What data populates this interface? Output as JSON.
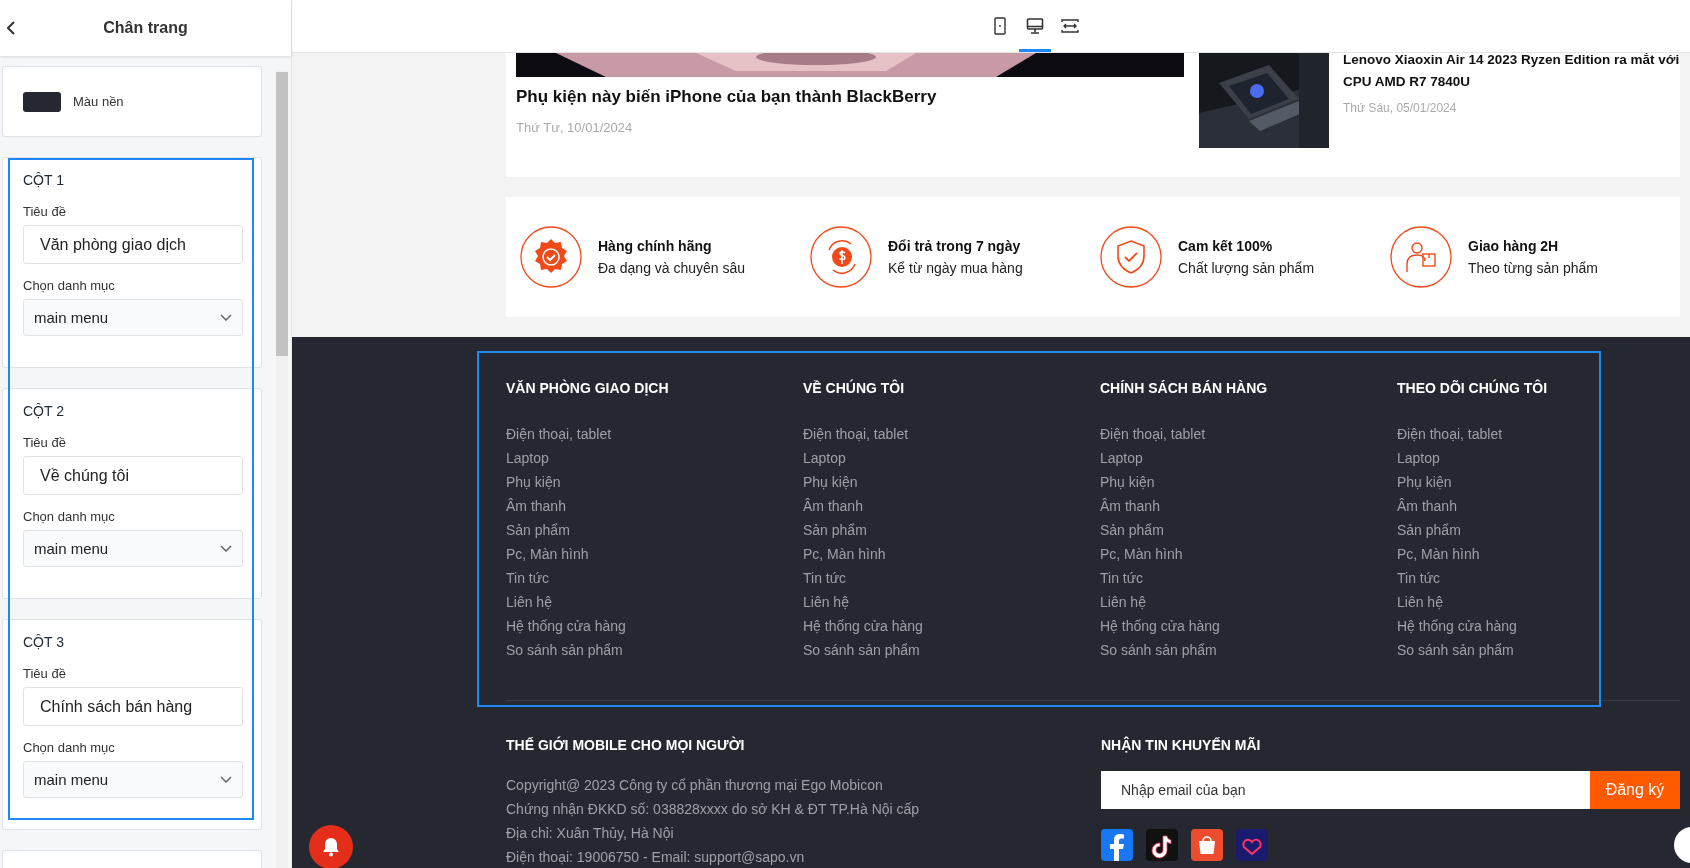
{
  "panel": {
    "title": "Chân trang",
    "background": {
      "label": "Màu nền",
      "color": "#252830"
    },
    "columns": [
      {
        "heading": "CỘT 1",
        "title_label": "Tiêu đề",
        "title_value": "Văn phòng giao dịch",
        "menu_label": "Chọn danh mục",
        "menu_value": "main menu"
      },
      {
        "heading": "CỘT 2",
        "title_label": "Tiêu đề",
        "title_value": "Về chúng tôi",
        "menu_label": "Chọn danh mục",
        "menu_value": "main menu"
      },
      {
        "heading": "CỘT 3",
        "title_label": "Tiêu đề",
        "title_value": "Chính sách bán hàng",
        "menu_label": "Chọn danh mục",
        "menu_value": "main menu"
      }
    ]
  },
  "toolbar": {
    "devices": [
      {
        "kind": "tablet",
        "selected": false
      },
      {
        "kind": "desktop",
        "selected": true
      },
      {
        "kind": "fit",
        "selected": false
      }
    ]
  },
  "news": {
    "main": {
      "kind": "picture",
      "title": "Phụ kiện này biến iPhone của bạn thành BlackBerry",
      "date": "Thứ Tư, 10/01/2024"
    },
    "side": {
      "kind": "picture",
      "title": "Lenovo Xiaoxin Air 14 2023 Ryzen Edition ra mắt với CPU AMD R7 7840U",
      "date": "Thứ Sáu, 05/01/2024"
    }
  },
  "features": [
    {
      "kind": "badge",
      "title": "Hàng chính hãng",
      "subtitle": "Đa dạng và chuyên sâu"
    },
    {
      "kind": "refund",
      "title": "Đổi trả trong 7 ngày",
      "subtitle": "Kể từ ngày mua hàng"
    },
    {
      "kind": "shield",
      "title": "Cam kết 100%",
      "subtitle": "Chất lượng sản phẩm"
    },
    {
      "kind": "delivery",
      "title": "Giao hàng 2H",
      "subtitle": "Theo từng sản phẩm"
    }
  ],
  "footer": {
    "columns": [
      {
        "heading": "VĂN PHÒNG GIAO DỊCH",
        "links": [
          "Điện thoại, tablet",
          "Laptop",
          "Phụ kiện",
          "Âm thanh",
          "Sản phẩm",
          "Pc, Màn hình",
          "Tin tức",
          "Liên hệ",
          "Hệ thống cửa hàng",
          "So sánh sản phẩm"
        ]
      },
      {
        "heading": "VỀ CHÚNG TÔI",
        "links": [
          "Điện thoại, tablet",
          "Laptop",
          "Phụ kiện",
          "Âm thanh",
          "Sản phẩm",
          "Pc, Màn hình",
          "Tin tức",
          "Liên hệ",
          "Hệ thống cửa hàng",
          "So sánh sản phẩm"
        ]
      },
      {
        "heading": "CHÍNH SÁCH BÁN HÀNG",
        "links": [
          "Điện thoại, tablet",
          "Laptop",
          "Phụ kiện",
          "Âm thanh",
          "Sản phẩm",
          "Pc, Màn hình",
          "Tin tức",
          "Liên hệ",
          "Hệ thống cửa hàng",
          "So sánh sản phẩm"
        ]
      },
      {
        "heading": "THEO DÕI CHÚNG TÔI",
        "links": [
          "Điện thoại, tablet",
          "Laptop",
          "Phụ kiện",
          "Âm thanh",
          "Sản phẩm",
          "Pc, Màn hình",
          "Tin tức",
          "Liên hệ",
          "Hệ thống cửa hàng",
          "So sánh sản phẩm"
        ]
      }
    ],
    "company": {
      "heading": "THẾ GIỚI MOBILE CHO MỌI NGƯỜI",
      "lines": [
        "Copyright@ 2023 Công ty cổ phần thương mại Ego Mobicon",
        "Chứng nhận ĐKKD số: 038828xxxx do sở KH & ĐT TP.Hà Nội cấp",
        "Địa chỉ: Xuân Thủy, Hà Nội",
        "Điện thoại: 19006750 - Email: support@sapo.vn"
      ]
    },
    "newsletter": {
      "heading": "NHẬN TIN KHUYẾN MÃI",
      "placeholder": "Nhập email của bạn",
      "button": "Đăng ký"
    },
    "socials": [
      {
        "kind": "facebook"
      },
      {
        "kind": "tiktok"
      },
      {
        "kind": "shopee"
      },
      {
        "kind": "lazada"
      }
    ]
  }
}
